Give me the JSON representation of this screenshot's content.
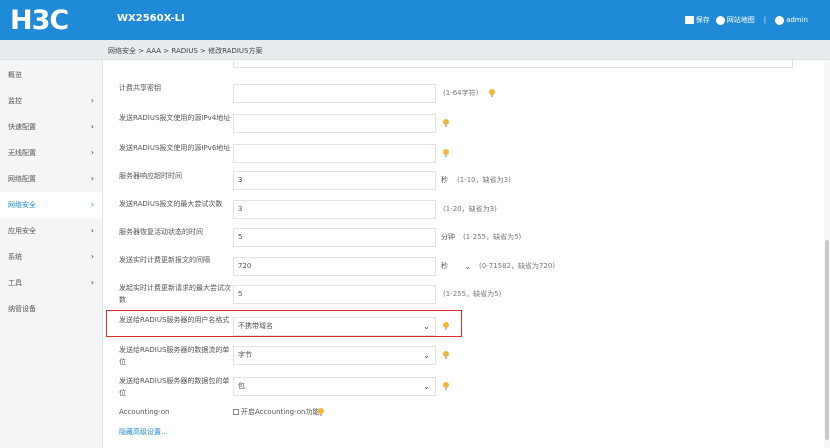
{
  "header": {
    "logo": "H3C",
    "model": "WX2560X-LI",
    "save_label": "保存",
    "sitemap_label": "网站地图",
    "separator": "|",
    "user_label": "admin"
  },
  "breadcrumb": "网络安全 > AAA > RADIUS > 修改RADIUS方案",
  "sidebar": {
    "items": [
      {
        "label": "概览",
        "chevron": ""
      },
      {
        "label": "监控",
        "chevron": "›"
      },
      {
        "label": "快速配置",
        "chevron": "›"
      },
      {
        "label": "无线配置",
        "chevron": "›"
      },
      {
        "label": "网络配置",
        "chevron": "›"
      },
      {
        "label": "网络安全",
        "chevron": "›"
      },
      {
        "label": "应用安全",
        "chevron": "›"
      },
      {
        "label": "系统",
        "chevron": "›"
      },
      {
        "label": "工具",
        "chevron": "›"
      },
      {
        "label": "纳管设备",
        "chevron": ""
      }
    ],
    "active_index": 5
  },
  "form": {
    "acct_key_label": "计费共享密钥",
    "acct_key_value": "",
    "acct_key_hint": "(1-64字符)",
    "src_ipv4_label": "发送RADIUS报文使用的源IPv4地址",
    "src_ipv4_value": "",
    "src_ipv6_label": "发送RADIUS报文使用的源IPv6地址",
    "src_ipv6_value": "",
    "timeout_label": "服务器响应超时时间",
    "timeout_value": "3",
    "timeout_unit": "秒",
    "timeout_hint": "(1-10，缺省为3)",
    "retry_label": "发送RADIUS报文的最大尝试次数",
    "retry_value": "3",
    "retry_hint": "(1-20，缺省为3)",
    "restore_label": "服务器恢复活动状态的时间",
    "restore_value": "5",
    "restore_unit": "分钟",
    "restore_hint": "(1-255，缺省为5)",
    "interval_label": "发送实时计费更新报文的间隔",
    "interval_value": "720",
    "interval_unit": "秒",
    "interval_hint": "(0-71582，缺省为720)",
    "max_req_label": "发起实时计费更新请求的最大尝试次数",
    "max_req_value": "5",
    "max_req_hint": "(1-255，缺省为5)",
    "username_fmt_label": "发送给RADIUS服务器的用户名格式",
    "username_fmt_value": "不携带域名",
    "data_unit_label": "发送给RADIUS服务器的数据流的单位",
    "data_unit_value": "字节",
    "packet_unit_label": "发送给RADIUS服务器的数据包的单位",
    "packet_unit_value": "包",
    "accounting_on_label": "Accounting-on",
    "accounting_on_checkbox": "开启Accounting-on功能",
    "advanced_link": "隐藏高级设置..."
  },
  "colors": {
    "brand": "#1f8bd8",
    "highlight": "#d9322f",
    "hint_bulb": "#f5b733"
  }
}
